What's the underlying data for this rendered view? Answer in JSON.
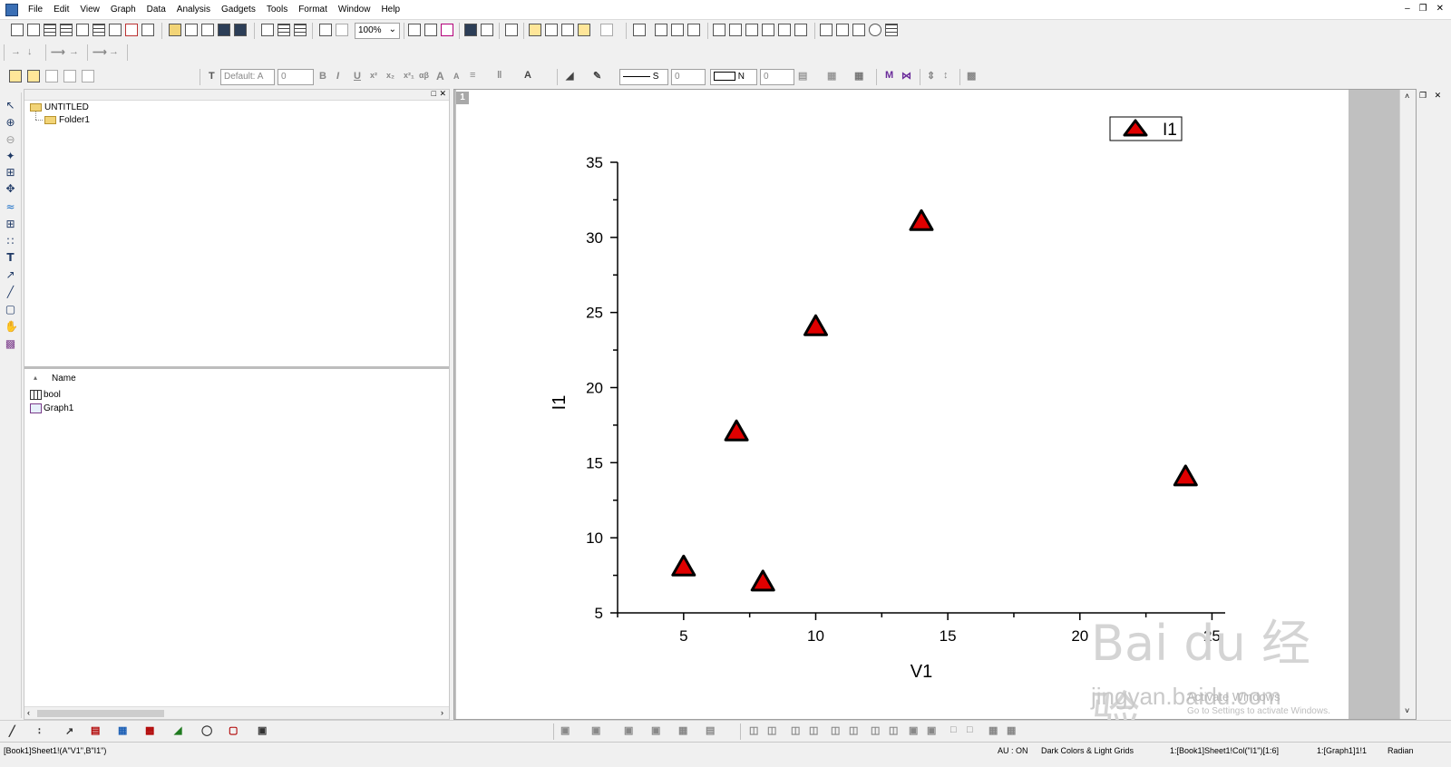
{
  "menu": {
    "items": [
      "File",
      "Edit",
      "View",
      "Graph",
      "Data",
      "Analysis",
      "Gadgets",
      "Tools",
      "Format",
      "Window",
      "Help"
    ]
  },
  "toolbar": {
    "zoom_value": "100%",
    "font_name": "Default: A",
    "font_size": "0",
    "bold_label": "B",
    "italic_label": "I",
    "underline_label": "U",
    "superscript_label": "x²",
    "subscript_label": "x₂",
    "greek_label": "αβ",
    "bigger_font_label": "A",
    "smaller_font_label": "A",
    "line_style_value": "S",
    "line_width_value": "0",
    "fill_value": "N",
    "fill_width_value": "0"
  },
  "explorer": {
    "folder_root": "UNTITLED",
    "folder_child": "Folder1",
    "column_header": "Name",
    "files": [
      {
        "name": "bool",
        "icon": "workbook-icon"
      },
      {
        "name": "Graph1",
        "icon": "graph-icon"
      }
    ]
  },
  "graph": {
    "layer_number": "1",
    "legend_label": "I1"
  },
  "chart_data": {
    "type": "scatter",
    "title": "",
    "xlabel": "V1",
    "ylabel": "I1",
    "xlim": [
      2.5,
      25.5
    ],
    "ylim": [
      5,
      35
    ],
    "xticks": [
      5,
      10,
      15,
      20,
      25
    ],
    "yticks": [
      5,
      10,
      15,
      20,
      25,
      30,
      35
    ],
    "grid": false,
    "legend_position": "top-right",
    "marker": "triangle",
    "marker_color": "#e00000",
    "series": [
      {
        "name": "I1",
        "x": [
          5,
          7,
          8,
          10,
          14,
          24
        ],
        "y": [
          8,
          17,
          7,
          24,
          31,
          14
        ]
      }
    ]
  },
  "watermark": {
    "logo_text": "Bai du 经验",
    "url_text": "jingyan.baidu.com",
    "activate_title": "Activate Windows",
    "activate_sub": "Go to Settings to activate Windows."
  },
  "status": {
    "left": "[Book1]Sheet1!(A\"V1\",B\"I1\")",
    "au": "AU : ON",
    "theme": "Dark Colors & Light Grids",
    "col": "1:[Book1]Sheet1!Col(\"I1\")[1:6]",
    "graph": "1:[Graph1]1!1",
    "unit": "Radian"
  }
}
